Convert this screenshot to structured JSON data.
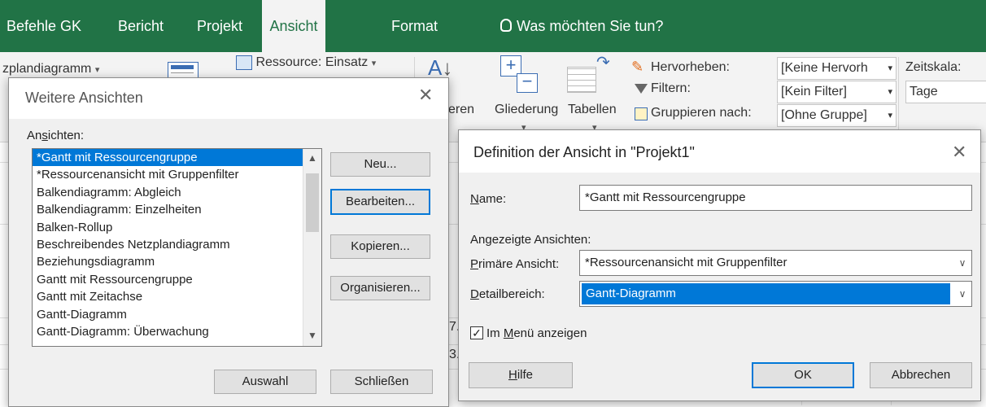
{
  "ribbon_tabs": {
    "befehle": "Befehle GK",
    "bericht": "Bericht",
    "projekt": "Projekt",
    "ansicht": "Ansicht",
    "format": "Format",
    "tell_me": "Was möchten Sie tun?"
  },
  "ribbon": {
    "netzplan": "zplandiagramm",
    "ressource_einsatz": "Ressource: Einsatz",
    "eren": "eren",
    "gliederung": "Gliederung",
    "tabellen": "Tabellen",
    "hervorheben_label": "Hervorheben:",
    "hervorheben_value": "[Keine Hervorh",
    "filtern_label": "Filtern:",
    "filtern_value": "[Kein Filter]",
    "gruppieren_label": "Gruppieren nach:",
    "gruppieren_value": "[Ohne Gruppe]",
    "zeitskala_label": "Zeitskala:",
    "zeitskala_value": "Tage"
  },
  "background": {
    "frag1": "7.",
    "frag2": "3."
  },
  "weitere_ansichten": {
    "title": "Weitere Ansichten",
    "ansichten_label": "Ansichten:",
    "items": [
      "*Gantt mit Ressourcengruppe",
      "*Ressourcenansicht mit Gruppenfilter",
      "Balkendiagramm: Abgleich",
      "Balkendiagramm: Einzelheiten",
      "Balken-Rollup",
      "Beschreibendes Netzplandiagramm",
      "Beziehungsdiagramm",
      "Gantt mit Ressourcengruppe",
      "Gantt mit Zeitachse",
      "Gantt-Diagramm",
      "Gantt-Diagramm: Überwachung"
    ],
    "buttons": {
      "neu": "Neu...",
      "bearbeiten": "Bearbeiten...",
      "kopieren": "Kopieren...",
      "organisieren": "Organisieren...",
      "auswahl": "Auswahl",
      "schliessen": "Schließen"
    }
  },
  "definition": {
    "title": "Definition der Ansicht in \"Projekt1\"",
    "name_label": "Name:",
    "name_value": "*Gantt mit Ressourcengruppe",
    "angezeigte_label": "Angezeigte Ansichten:",
    "primaer_label": "Primäre Ansicht:",
    "primaer_value": "*Ressourcenansicht mit Gruppenfilter",
    "detail_label": "Detailbereich:",
    "detail_value": "Gantt-Diagramm",
    "im_menu_label": "Im Menü anzeigen",
    "im_menu_checked": true,
    "buttons": {
      "hilfe": "Hilfe",
      "ok": "OK",
      "abbrechen": "Abbrechen"
    }
  }
}
